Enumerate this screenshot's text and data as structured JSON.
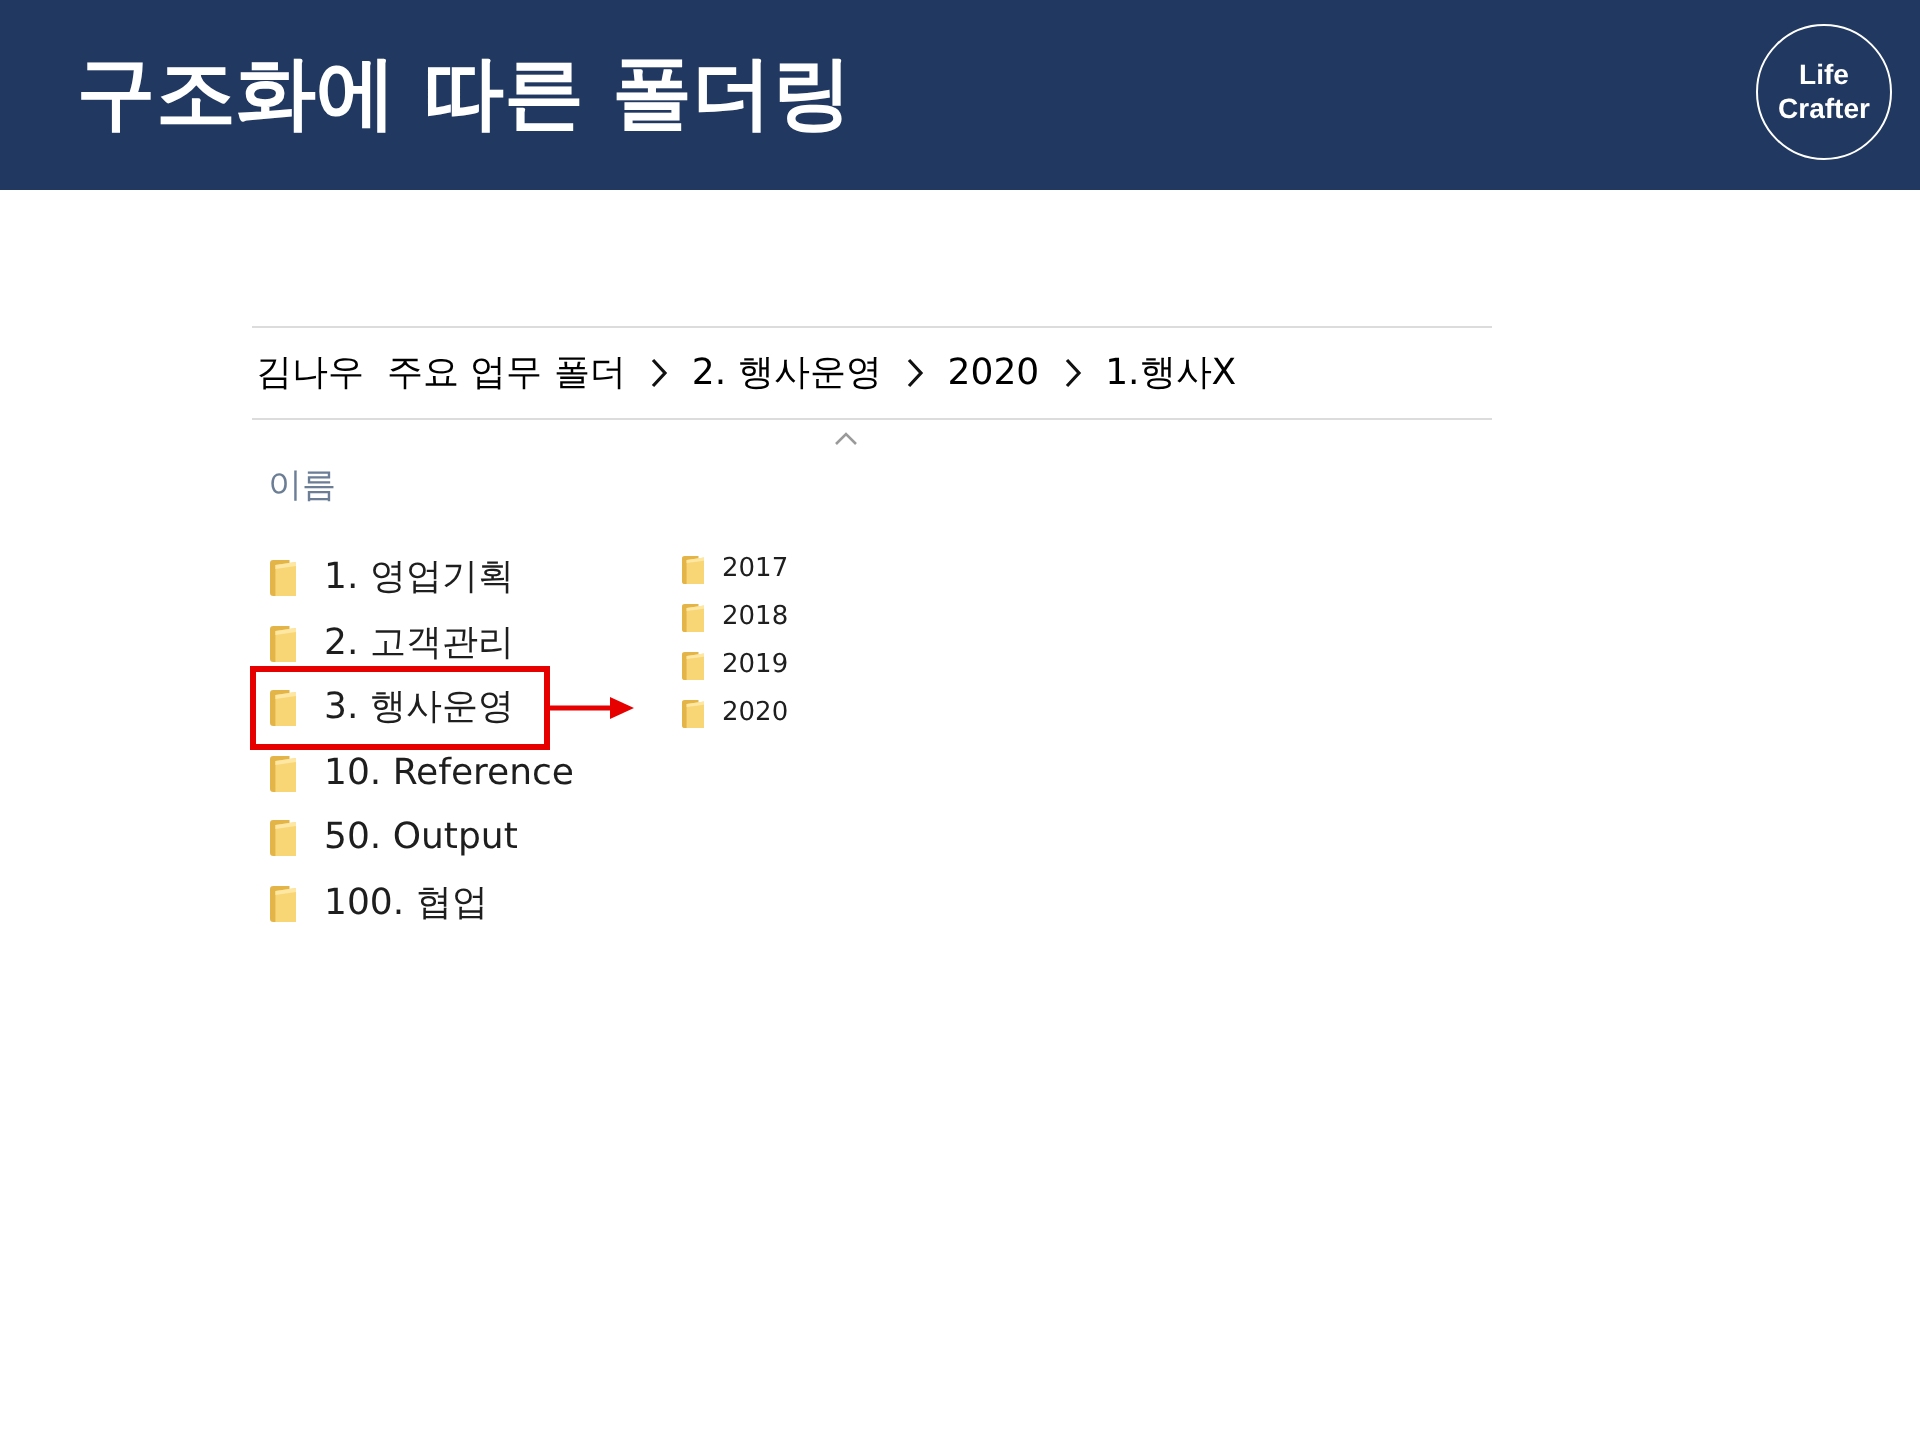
{
  "header": {
    "title": "구조화에 따른 폴더링",
    "logo": "Life Crafter"
  },
  "breadcrumb": [
    "김나우  주요 업무 폴더",
    "2. 행사운영",
    "2020",
    "1.행사X"
  ],
  "file_list": {
    "column_header": "이름",
    "folders": [
      {
        "name": "1. 영업기획",
        "highlighted": false
      },
      {
        "name": "2. 고객관리",
        "highlighted": false
      },
      {
        "name": "3. 행사운영",
        "highlighted": true
      },
      {
        "name": "10. Reference",
        "highlighted": false
      },
      {
        "name": "50. Output",
        "highlighted": false
      },
      {
        "name": "100. 협업",
        "highlighted": false
      }
    ]
  },
  "subfolders": [
    "2017",
    "2018",
    "2019",
    "2020"
  ]
}
